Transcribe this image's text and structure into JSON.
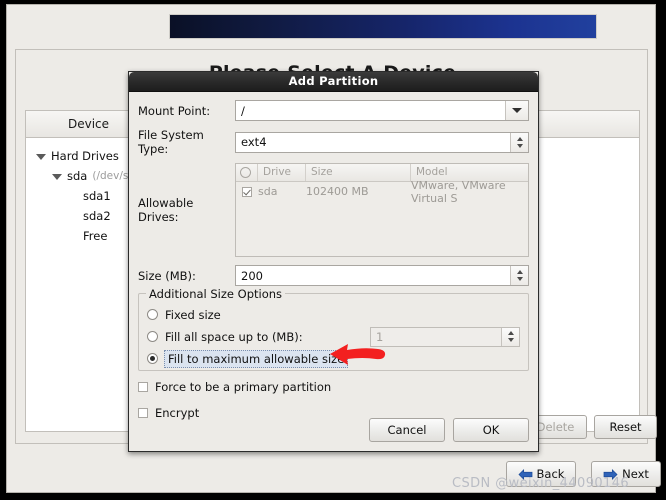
{
  "installer": {
    "page_title": "Please Select A Device",
    "device_column_header": "Device",
    "tree": [
      {
        "label": "Hard Drives",
        "sub": "",
        "indent": 0,
        "expanded": true
      },
      {
        "label": "sda",
        "sub": "(/dev/sda)",
        "indent": 1,
        "expanded": true
      },
      {
        "label": "sda1",
        "sub": "",
        "indent": 2,
        "expanded": false
      },
      {
        "label": "sda2",
        "sub": "",
        "indent": 2,
        "expanded": false
      },
      {
        "label": "Free",
        "sub": "",
        "indent": 2,
        "expanded": false
      }
    ],
    "buttons": {
      "delete": "Delete",
      "reset": "Reset",
      "back": "Back",
      "next": "Next"
    }
  },
  "dialog": {
    "title": "Add Partition",
    "mount_point": {
      "label": "Mount Point:",
      "value": "/"
    },
    "file_system_type": {
      "label": "File System Type:",
      "value": "ext4"
    },
    "allowable_drives": {
      "label": "Allowable Drives:",
      "columns": [
        "",
        "Drive",
        "Size",
        "Model"
      ],
      "rows": [
        {
          "checked": true,
          "drive": "sda",
          "size": "102400 MB",
          "model": "VMware, VMware Virtual S"
        }
      ]
    },
    "size": {
      "label": "Size (MB):",
      "value": "200"
    },
    "additional_size_options": {
      "legend": "Additional Size Options",
      "options": [
        {
          "label": "Fixed size",
          "selected": false
        },
        {
          "label": "Fill all space up to (MB):",
          "selected": false,
          "spin_value": "1"
        },
        {
          "label": "Fill to maximum allowable size",
          "selected": true
        }
      ]
    },
    "checkboxes": [
      {
        "label": "Force to be a primary partition",
        "checked": false
      },
      {
        "label": "Encrypt",
        "checked": false
      }
    ],
    "buttons": {
      "cancel": "Cancel",
      "ok": "OK"
    }
  },
  "annotation": {
    "arrow": "red-left-arrow"
  },
  "watermark": {
    "text": "CSDN @weixin_44090146"
  },
  "colors": {
    "banner_dark": "#0a1026",
    "banner_blue": "#21409e",
    "annotation_red": "#f32020",
    "focus_highlight": "#dbe4f0",
    "titlebar": "#2a2a2a"
  }
}
